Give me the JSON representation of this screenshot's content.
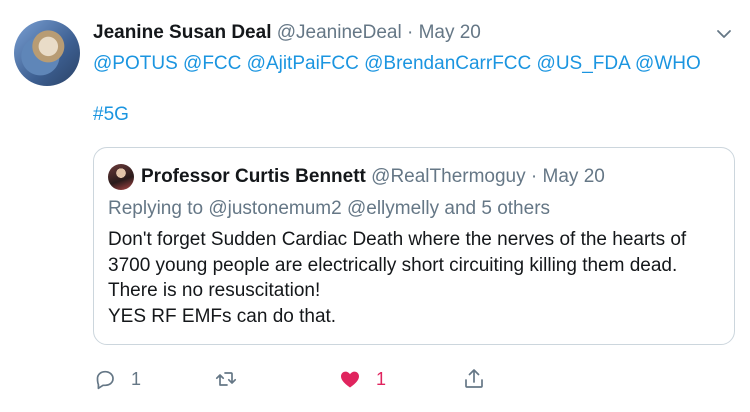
{
  "tweet": {
    "author_name": "Jeanine Susan Deal",
    "author_handle": "@JeanineDeal",
    "separator": " · ",
    "date": "May 20",
    "mentions": [
      "@POTUS",
      "@FCC",
      "@AjitPaiFCC",
      "@BrendanCarrFCC",
      "@US_FDA",
      "@WHO"
    ],
    "hashtag": "#5G"
  },
  "quote": {
    "author_name": "Professor Curtis Bennett",
    "author_handle": "@RealThermoguy",
    "separator": " · ",
    "date": "May 20",
    "reply_prefix": "Replying to ",
    "reply_user1": "@justonemum2",
    "reply_user2": "@ellymelly",
    "reply_suffix": " and 5 others",
    "body_lines": [
      "Don't forget Sudden Cardiac Death where the nerves of the hearts of",
      "3700 young people are electrically short circuiting killing them dead.",
      "There is no resuscitation!",
      "YES RF EMFs can do that."
    ]
  },
  "actions": {
    "reply_count": "1",
    "retweet_count": "",
    "like_count": "1"
  },
  "icons": {
    "caret": "chevron-down-icon",
    "reply": "reply-icon",
    "retweet": "retweet-icon",
    "like": "heart-icon",
    "share": "share-icon"
  },
  "colors": {
    "link": "#1b95e0",
    "muted": "#657786",
    "like": "#e0245e",
    "border": "#ccd6dd"
  }
}
